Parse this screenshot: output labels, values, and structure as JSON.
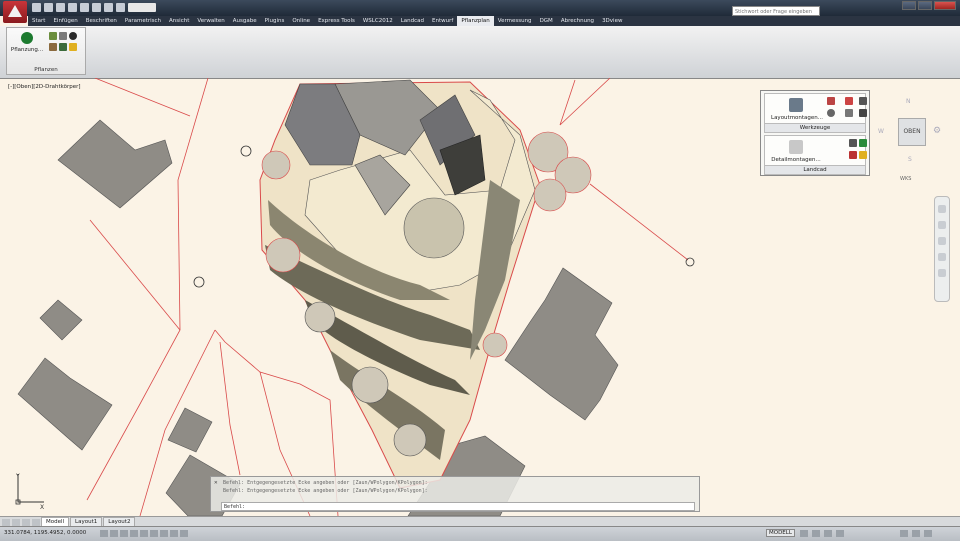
{
  "ribbon": {
    "tabs": [
      "Start",
      "Einfügen",
      "Beschriften",
      "Parametrisch",
      "Ansicht",
      "Verwalten",
      "Ausgabe",
      "Plugins",
      "Online",
      "Express Tools",
      "WSLC2012",
      "Landcad",
      "Entwurf",
      "Pflanzplan",
      "Vermessung",
      "DGM",
      "Abrechnung",
      "3Dview"
    ],
    "active_tab": "Pflanzplan",
    "panel_title": "Pflanzen",
    "big_button_label": "Pflanzung..."
  },
  "search": {
    "placeholder": "Stichwort oder Frage eingeben"
  },
  "viewport": {
    "label": "[-][Oben][2D-Drahtkörper]"
  },
  "tool_palette": {
    "section1_button": "Layoutmontagen...",
    "section1_caption": "Werkzeuge",
    "section2_button": "Detailmontagen...",
    "section2_caption": "Landcad"
  },
  "viewcube": {
    "center": "OBEN",
    "west": "W",
    "north": "N",
    "south": "S",
    "wcs": "WKS"
  },
  "command": {
    "history": [
      "Befehl: Entgegengesetzte Ecke angeben oder [Zaun/WPolygon/KPolygon]:",
      "Befehl: Entgegengesetzte Ecke angeben oder [Zaun/WPolygon/KPolygon]:"
    ],
    "prompt": "Befehl:"
  },
  "layouts": {
    "tabs": [
      "Modell",
      "Layout1",
      "Layout2"
    ],
    "active": "Modell"
  },
  "status": {
    "coords": "331.0784, 1195.4952, 0.0000",
    "model_label": "MODELL"
  },
  "ucs": {
    "x": "X",
    "y": "Y"
  },
  "colors": {
    "background": "#fbf3e6",
    "boundary": "#d94a4a",
    "building": "#8f8c86",
    "titlebar": "#1f2a38"
  }
}
